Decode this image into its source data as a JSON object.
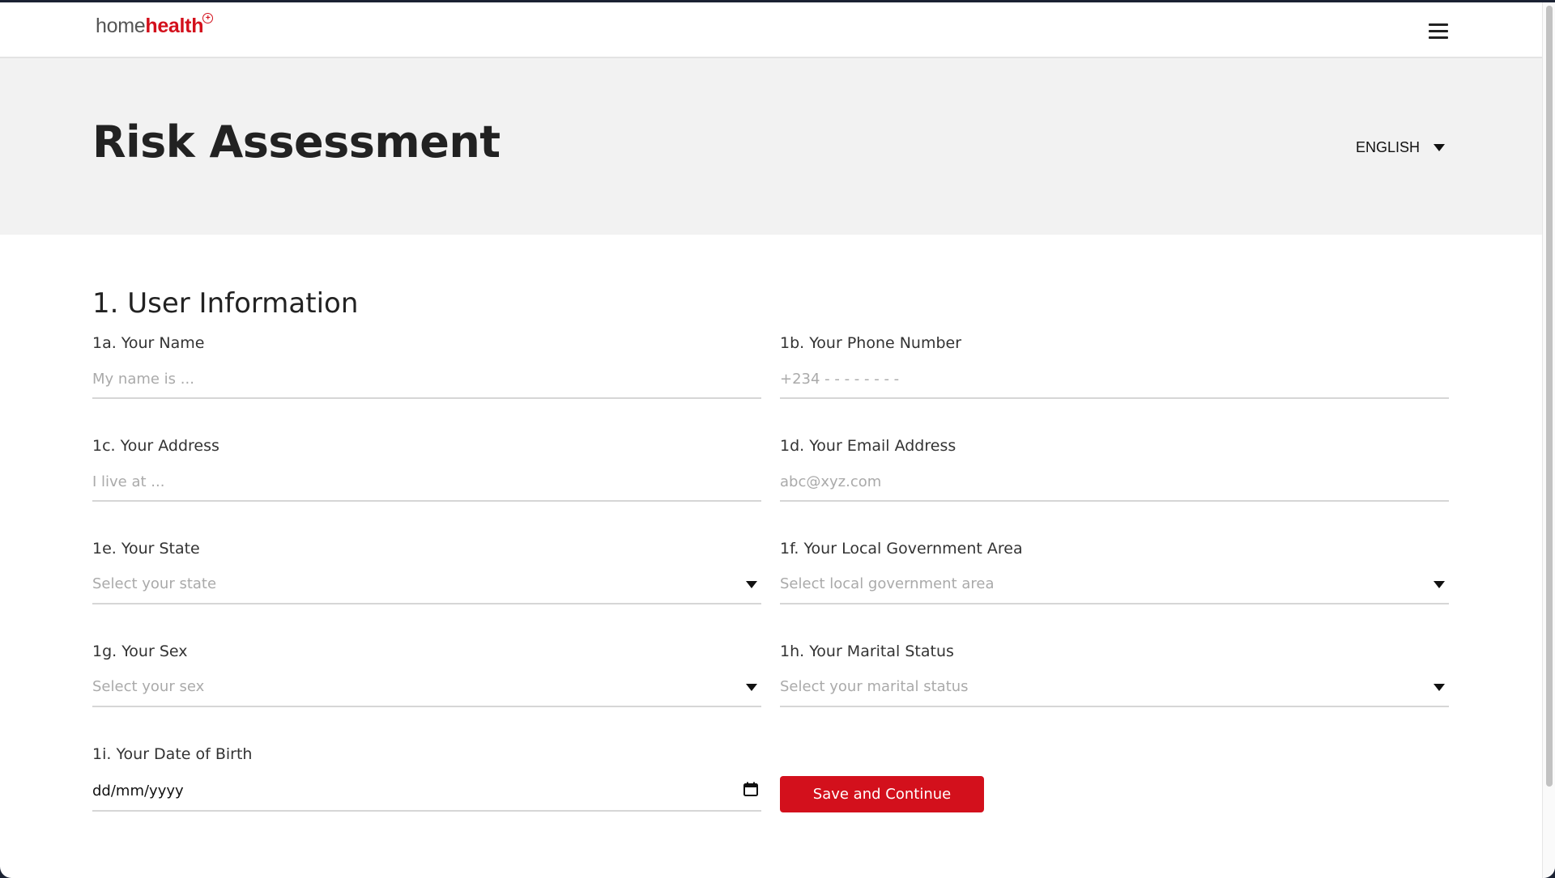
{
  "brand": {
    "part1": "home",
    "part2": "health",
    "mark": "+"
  },
  "header": {
    "title": "Risk Assessment",
    "language": "ENGLISH"
  },
  "section": {
    "title": "1. User Information"
  },
  "fields": {
    "name": {
      "label": "1a. Your Name",
      "placeholder": "My name is ..."
    },
    "phone": {
      "label": "1b. Your Phone Number",
      "placeholder": "+234 - - - - - - - -"
    },
    "address": {
      "label": "1c. Your Address",
      "placeholder": "I live at ..."
    },
    "email": {
      "label": "1d. Your Email Address",
      "placeholder": "abc@xyz.com"
    },
    "state": {
      "label": "1e. Your State",
      "placeholder": "Select your state"
    },
    "lga": {
      "label": "1f. Your Local Government Area",
      "placeholder": "Select local government area"
    },
    "sex": {
      "label": "1g. Your Sex",
      "placeholder": "Select your sex"
    },
    "marital": {
      "label": "1h. Your Marital Status",
      "placeholder": "Select your marital status"
    },
    "dob": {
      "label": "1i. Your Date of Birth",
      "value": "dd/mm/yyyy"
    }
  },
  "actions": {
    "save_label": "Save and Continue"
  },
  "colors": {
    "brand_red": "#d3101c",
    "hero_bg": "#f2f2f2",
    "text": "#222222"
  },
  "icons": {
    "menu": "hamburger-icon",
    "dropdown": "caret-down-icon",
    "calendar": "calendar-icon"
  }
}
